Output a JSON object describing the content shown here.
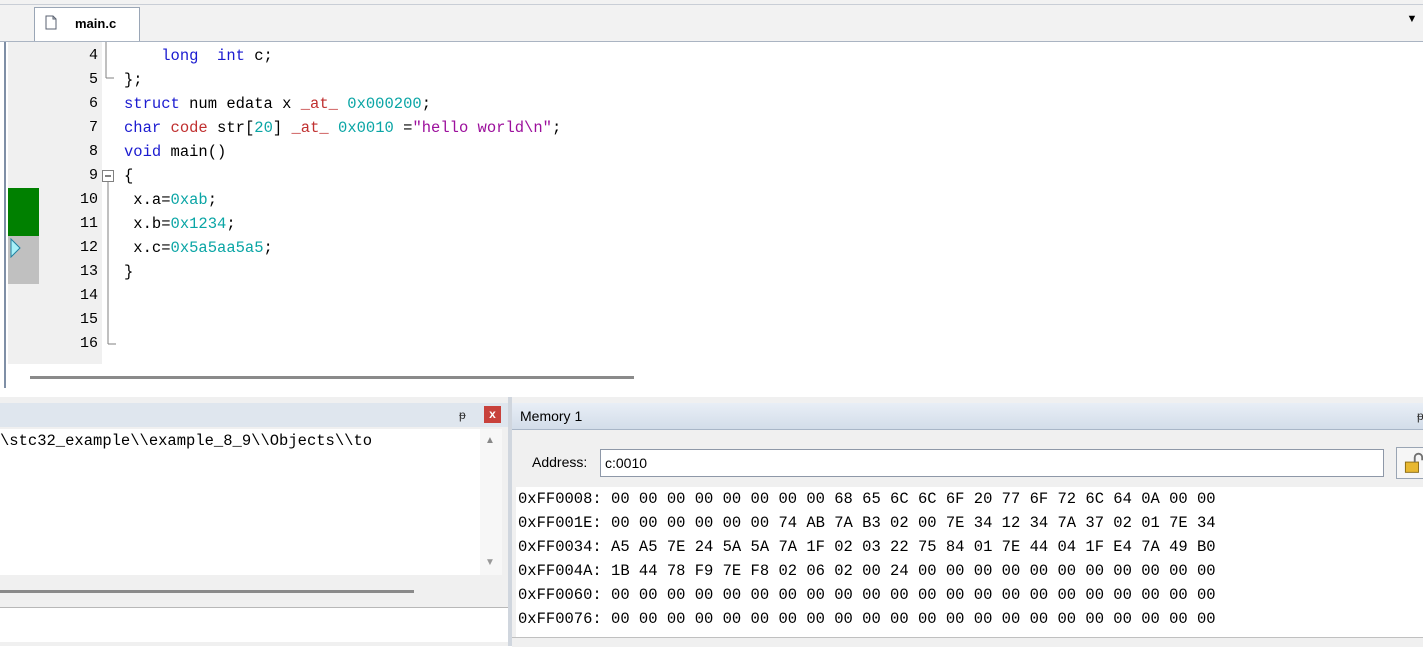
{
  "editor": {
    "tab_label": "main.c",
    "dropdown_glyph": "▼",
    "line_numbers": [
      "4",
      "5",
      "6",
      "7",
      "8",
      "9",
      "10",
      "11",
      "12",
      "13",
      "14",
      "15",
      "16"
    ],
    "current_line": "12"
  },
  "command_panel": {
    "pin_glyph": "ᵽ",
    "close_glyph": "x",
    "output_line": "\\stc32_example\\\\example_8_9\\\\Objects\\\\to"
  },
  "memory": {
    "title": "Memory 1",
    "pin_glyph": "ᵽ",
    "address_label": "Address:",
    "address_value": "c:0010",
    "rows": [
      "0xFF0008: 00 00 00 00 00 00 00 00 68 65 6C 6C 6F 20 77 6F 72 6C 64 0A 00 00",
      "0xFF001E: 00 00 00 00 00 00 74 AB 7A B3 02 00 7E 34 12 34 7A 37 02 01 7E 34",
      "0xFF0034: A5 A5 7E 24 5A 5A 7A 1F 02 03 22 75 84 01 7E 44 04 1F E4 7A 49 B0",
      "0xFF004A: 1B 44 78 F9 7E F8 02 06 02 00 24 00 00 00 00 00 00 00 00 00 00 00",
      "0xFF0060: 00 00 00 00 00 00 00 00 00 00 00 00 00 00 00 00 00 00 00 00 00 00",
      "0xFF0076: 00 00 00 00 00 00 00 00 00 00 00 00 00 00 00 00 00 00 00 00 00 00"
    ]
  },
  "colors": {
    "keyword": "#1b1bd0",
    "number": "#0aa5a5",
    "string": "#9c0f9c",
    "at_keyword": "#c03030",
    "executed_marker": "#008000"
  }
}
